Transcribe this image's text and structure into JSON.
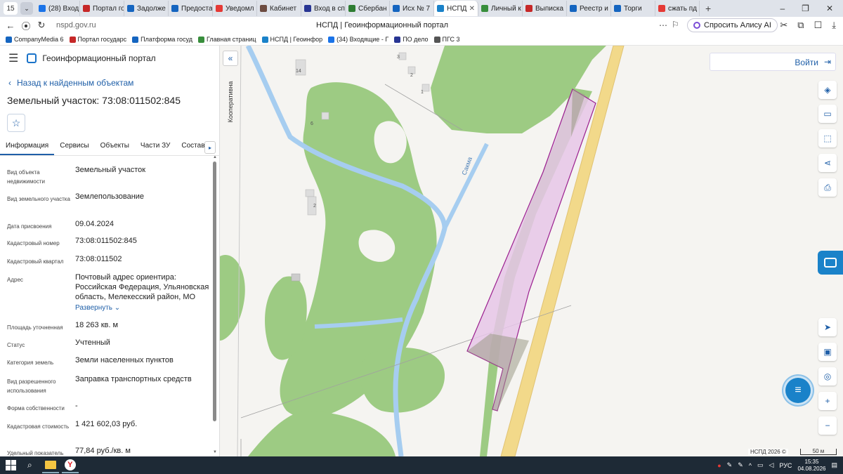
{
  "browser": {
    "tab_count": "15",
    "tabs": [
      {
        "label": "(28) Вход",
        "color": "#1a73e8"
      },
      {
        "label": "Портал го",
        "color": "#c62828"
      },
      {
        "label": "Задолже",
        "color": "#1565c0"
      },
      {
        "label": "Предоста",
        "color": "#1565c0"
      },
      {
        "label": "Уведомл",
        "color": "#e53935"
      },
      {
        "label": "Кабинет",
        "color": "#6d4c41"
      },
      {
        "label": "Вход в сп",
        "color": "#283593"
      },
      {
        "label": "Сбербан",
        "color": "#2e7d32"
      },
      {
        "label": "Исх № 7",
        "color": "#1565c0"
      },
      {
        "label": "НСПД",
        "color": "#1a82c9"
      },
      {
        "label": "Личный к",
        "color": "#388e3c"
      },
      {
        "label": "Выписка",
        "color": "#c62828"
      },
      {
        "label": "Реестр и",
        "color": "#1565c0"
      },
      {
        "label": "Торги",
        "color": "#1565c0"
      },
      {
        "label": "сжать пд",
        "color": "#e53935"
      }
    ],
    "active_tab_index": 9,
    "url": "nspd.gov.ru",
    "page_title": "НСПД | Геоинформационный портал",
    "alice_label": "Спросить Алису AI",
    "bookmarks": [
      {
        "label": "CompanyMedia 6",
        "color": "#1565c0"
      },
      {
        "label": "Портал государс",
        "color": "#c62828"
      },
      {
        "label": "Платформа госуд",
        "color": "#1565c0"
      },
      {
        "label": "Главная страниц",
        "color": "#388e3c"
      },
      {
        "label": "НСПД | Геоинфор",
        "color": "#1a82c9"
      },
      {
        "label": "(34) Входящие - Г",
        "color": "#1a73e8"
      },
      {
        "label": "ПО дело",
        "color": "#283593"
      },
      {
        "label": "ПГС 3",
        "color": "#555555"
      }
    ]
  },
  "sidebar": {
    "portal_name": "Геоинформационный портал",
    "back_label": "Назад к найденным объектам",
    "object_title": "Земельный участок: 73:08:011502:845",
    "tabs": [
      "Информация",
      "Сервисы",
      "Объекты",
      "Части ЗУ",
      "Состав"
    ],
    "active_tab": 0,
    "fields": [
      {
        "label": "Вид объекта недвижимости",
        "value": "Земельный участок"
      },
      {
        "label": "Вид земельного участка",
        "value": "Землепользование"
      },
      {
        "label": "Дата присвоения",
        "value": "09.04.2024"
      },
      {
        "label": "Кадастровый номер",
        "value": "73:08:011502:845"
      },
      {
        "label": "Кадастровый квартал",
        "value": "73:08:011502"
      },
      {
        "label": "Адрес",
        "value": "Почтовый адрес ориентира: Российская Федерация, Ульяновская область, Мелекесский район, МО"
      },
      {
        "label": "Площадь уточненная",
        "value": "18 263 кв. м"
      },
      {
        "label": "Статус",
        "value": "Учтенный"
      },
      {
        "label": "Категория земель",
        "value": "Земли населенных пунктов"
      },
      {
        "label": "Вид разрешенного использования",
        "value": "Заправка транспортных средств"
      },
      {
        "label": "Форма собственности",
        "value": "-"
      },
      {
        "label": "Кадастровая стоимость",
        "value": "1 421 602,03 руб."
      },
      {
        "label": "Удельный показатель",
        "value": "77,84 руб./кв. м"
      }
    ],
    "expand_label": "Развернуть"
  },
  "map": {
    "login_label": "Войти",
    "labels": {
      "street": "Кооперативна",
      "river": "Сакма",
      "house_14": "14",
      "house_3": "3",
      "house_2a": "2",
      "house_1": "1",
      "house_6": "6",
      "house_2b": "2"
    },
    "attribution": "НСПД 2026 ©",
    "scale": "50 м",
    "colors": {
      "parcel_fill": "#e6c6e8",
      "parcel_stroke": "#9b1f8f",
      "forest": "#9dcb83",
      "water": "#a6cdf0",
      "road": "#f2d98a",
      "accent": "#1a82c9"
    }
  },
  "taskbar": {
    "lang": "РУС",
    "time": "15:35",
    "date": "04.08.2026"
  }
}
